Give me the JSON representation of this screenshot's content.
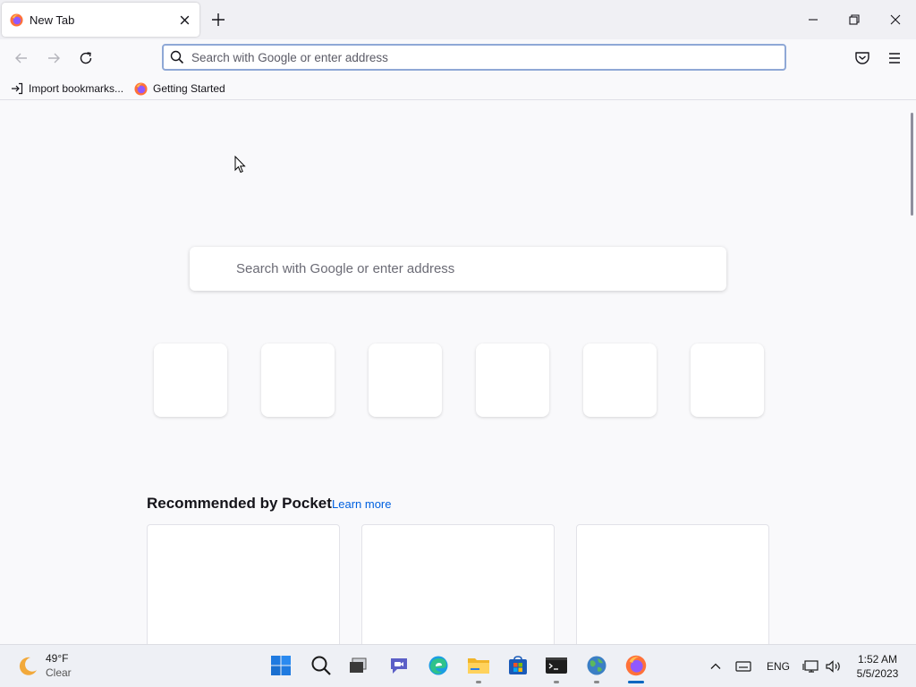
{
  "browser": {
    "tab": {
      "title": "New Tab"
    },
    "urlbar": {
      "placeholder": "Search with Google or enter address",
      "value": ""
    },
    "bookmarks": [
      {
        "label": "Import bookmarks..."
      },
      {
        "label": "Getting Started"
      }
    ]
  },
  "newtab": {
    "search": {
      "placeholder": "Search with Google or enter address"
    },
    "top_sites_count": 6,
    "pocket": {
      "title": "Recommended by Pocket",
      "learn_more": "Learn more"
    }
  },
  "taskbar": {
    "weather": {
      "temperature": "49°F",
      "condition": "Clear"
    },
    "apps": [
      "start-icon",
      "search-icon",
      "task-view-icon",
      "chat-icon",
      "edge-icon",
      "file-explorer-icon",
      "store-icon",
      "terminal-icon",
      "globe-icon",
      "firefox-icon"
    ],
    "language": "ENG",
    "clock": {
      "time": "1:52 AM",
      "date": "5/5/2023"
    }
  },
  "colors": {
    "accent": "#0061e0",
    "urlbar_focus": "#8fa8d6",
    "firefox_orange": "#ff7139"
  }
}
